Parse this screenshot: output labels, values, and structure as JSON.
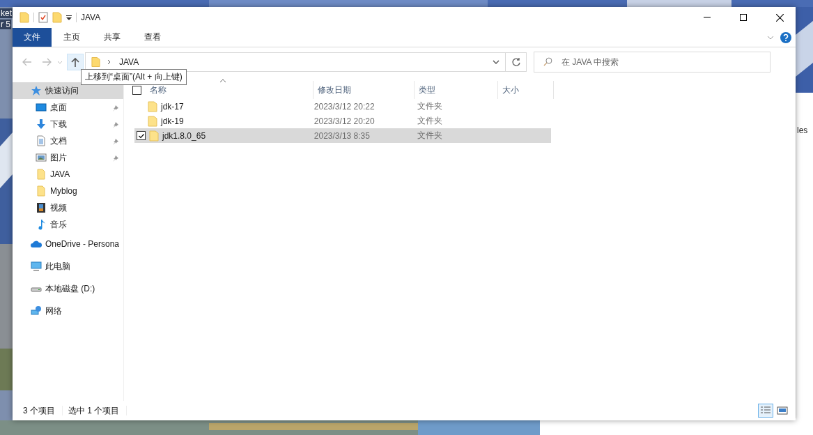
{
  "desktop": {
    "labels": [
      "ket",
      "r 5"
    ],
    "side_window_text": "les"
  },
  "window": {
    "title": "JAVA"
  },
  "ribbon_tabs": [
    {
      "label": "文件",
      "kind": "file"
    },
    {
      "label": "主页",
      "kind": "tab"
    },
    {
      "label": "共享",
      "kind": "tab"
    },
    {
      "label": "查看",
      "kind": "tab"
    }
  ],
  "address": {
    "path": [
      "JAVA"
    ]
  },
  "tooltip": "上移到“桌面”(Alt + 向上键)",
  "search": {
    "placeholder": "在 JAVA 中搜索"
  },
  "sidebar": {
    "items": [
      {
        "label": "快速访问",
        "kind": "star",
        "selected": true,
        "children": [
          {
            "label": "桌面",
            "kind": "desktop",
            "pinned": true
          },
          {
            "label": "下载",
            "kind": "download",
            "pinned": true
          },
          {
            "label": "文档",
            "kind": "document",
            "pinned": true
          },
          {
            "label": "图片",
            "kind": "pictures",
            "pinned": true
          },
          {
            "label": "JAVA",
            "kind": "folder",
            "pinned": false
          },
          {
            "label": "Myblog",
            "kind": "folder",
            "pinned": false
          },
          {
            "label": "视频",
            "kind": "video",
            "pinned": false
          },
          {
            "label": "音乐",
            "kind": "music",
            "pinned": false
          }
        ]
      },
      {
        "label": "OneDrive - Persona",
        "kind": "cloud",
        "selected": false
      },
      {
        "label": "此电脑",
        "kind": "computer",
        "selected": false
      },
      {
        "label": "本地磁盘 (D:)",
        "kind": "drive",
        "selected": false
      },
      {
        "label": "网络",
        "kind": "network",
        "selected": false
      }
    ]
  },
  "table": {
    "columns": [
      "名称",
      "修改日期",
      "类型",
      "大小"
    ],
    "all_checked": false,
    "rows": [
      {
        "name": "jdk-17",
        "modified": "2023/3/12 20:22",
        "type": "文件夹",
        "selected": false,
        "checked": false
      },
      {
        "name": "jdk-19",
        "modified": "2023/3/12 20:20",
        "type": "文件夹",
        "selected": false,
        "checked": false
      },
      {
        "name": "jdk1.8.0_65",
        "modified": "2023/3/13 8:35",
        "type": "文件夹",
        "selected": true,
        "checked": true
      }
    ]
  },
  "status_bar": {
    "item_count": "3 个项目",
    "selection": "选中 1 个项目",
    "views": [
      {
        "kind": "details",
        "selected": true
      },
      {
        "kind": "large",
        "selected": false
      }
    ]
  }
}
